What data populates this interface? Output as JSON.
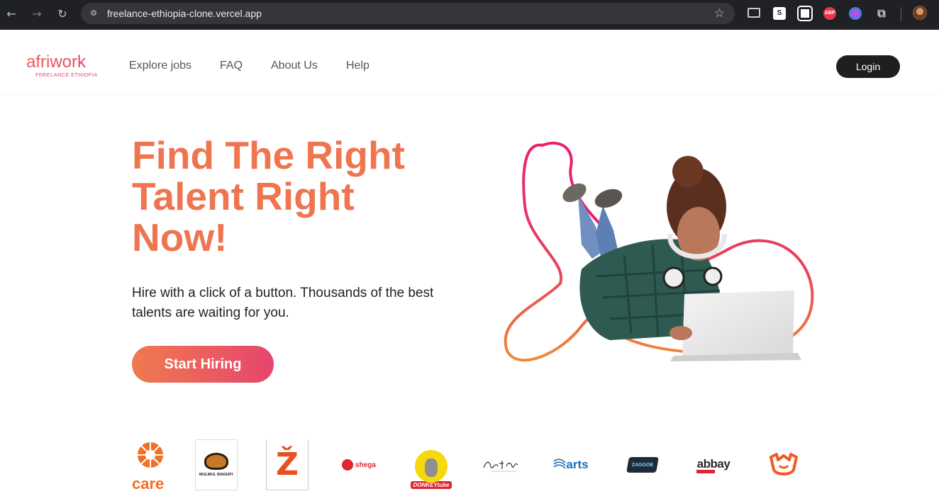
{
  "browser": {
    "url": "freelance-ethiopia-clone.vercel.app",
    "extensions": [
      "reader-icon",
      "s-extension-icon",
      "qr-icon",
      "adblock-icon",
      "brain-icon",
      "puzzle-icon"
    ],
    "ext_labels": {
      "s": "S",
      "abp": "ABP"
    }
  },
  "header": {
    "logo_word": "afriwork",
    "logo_sub": "FREELANCE ETHIOPIA",
    "nav": [
      "Explore jobs",
      "FAQ",
      "About Us",
      "Help"
    ],
    "login_label": "Login"
  },
  "hero": {
    "title_lines": [
      "Find The Right",
      "Talent Right",
      "Now!"
    ],
    "subtitle": "Hire with a click of a button. Thousands of the best talents are waiting for you.",
    "cta_label": "Start Hiring"
  },
  "partners": [
    {
      "name": "care",
      "text": "care"
    },
    {
      "name": "mulmul-bakery",
      "text": "MULMUL BAKERY"
    },
    {
      "name": "z-logo",
      "text": "Ž"
    },
    {
      "name": "shega",
      "text": "shega"
    },
    {
      "name": "donkey-tube",
      "text": "DONKEYtube"
    },
    {
      "name": "script-logo",
      "text": ""
    },
    {
      "name": "arts",
      "text": "arts"
    },
    {
      "name": "zaggoe",
      "text": "ZAGGOE"
    },
    {
      "name": "abbay-media",
      "text": "abbay"
    },
    {
      "name": "orange-emblem",
      "text": ""
    }
  ],
  "colors": {
    "accent_orange": "#ee7550",
    "accent_pink": "#e6456d",
    "chrome_bg": "#202124",
    "login_bg": "#1f1f1f"
  }
}
